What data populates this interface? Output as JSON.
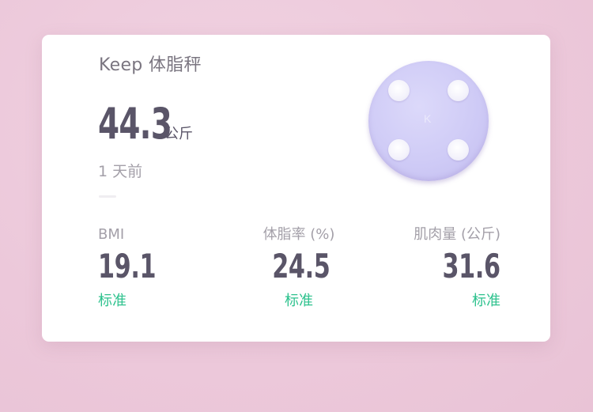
{
  "card": {
    "title": "Keep 体脂秤",
    "weight": {
      "value": "44.3",
      "unit": "公斤"
    },
    "time_ago": "1 天前"
  },
  "device": {
    "name": "scale-icon",
    "logo": "K",
    "color": "#cfcbf6"
  },
  "metrics": [
    {
      "label": "BMI",
      "value": "19.1",
      "status": "标准"
    },
    {
      "label": "体脂率 (%)",
      "value": "24.5",
      "status": "标准"
    },
    {
      "label": "肌肉量 (公斤)",
      "value": "31.6",
      "status": "标准"
    }
  ],
  "colors": {
    "accent_status": "#2ec28e",
    "value_text": "#5a5568",
    "background": "#ecc8da"
  }
}
